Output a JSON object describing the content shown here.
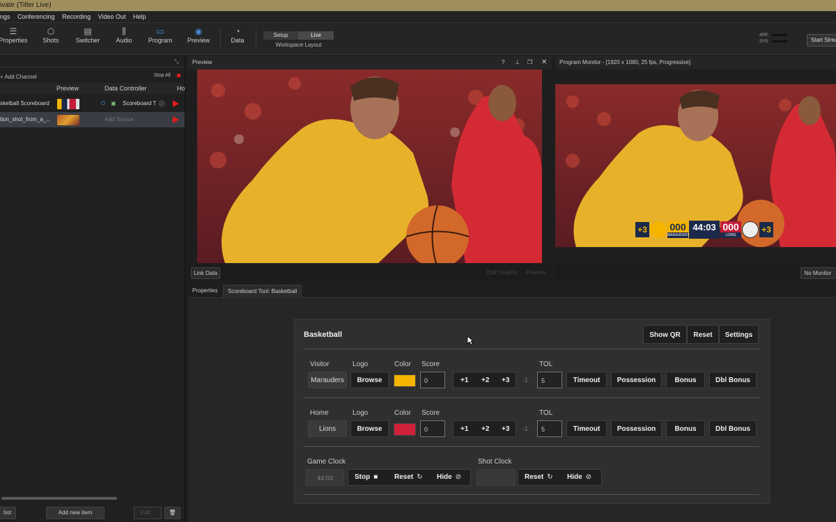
{
  "window": {
    "title": "ivate (Titler Live)"
  },
  "menu": [
    "ngs",
    "Conferencing",
    "Recording",
    "Video Out",
    "Help"
  ],
  "toolbar": {
    "items": [
      {
        "label": "Properties",
        "icon": "list-icon"
      },
      {
        "label": "Shots",
        "icon": "cube-icon"
      },
      {
        "label": "Switcher",
        "icon": "switcher-icon"
      },
      {
        "label": "Audio",
        "icon": "sliders-icon"
      },
      {
        "label": "Program",
        "icon": "monitor-icon"
      },
      {
        "label": "Preview",
        "icon": "eye-icon"
      },
      {
        "label": "Data",
        "icon": "pie-chart-icon"
      }
    ],
    "workspace": {
      "setup": "Setup",
      "live": "Live",
      "label": "Workspace Layout"
    },
    "meters": {
      "app": "APP:",
      "sys": "SYS:"
    },
    "start_stream": "Start Stream"
  },
  "channels": {
    "add_channel": "+ Add Channel",
    "stop_all": "Stop All",
    "columns": {
      "preview": "Preview",
      "data_controller": "Data Controller",
      "hotkey": "Ho"
    },
    "rows": [
      {
        "name": "sketball Scoreboard",
        "controller": "Scoreboard T"
      },
      {
        "name": "tion_shot_from_a_...",
        "controller": "Add Source"
      }
    ],
    "bottom": {
      "shot": "hot",
      "add_new_item": "Add new item",
      "edit": "Edit..."
    }
  },
  "preview_monitor": {
    "title": "Preview",
    "link_data": "Link Data",
    "edit_graphic": "Edit Graphic",
    "preview_btn": "Preview"
  },
  "program_monitor": {
    "title": "Program Monitor - [1920 x 1080, 25 fps, Progressive]",
    "no_monitor": "No Monitor"
  },
  "overlay": {
    "plus_left": "+3",
    "visitor_score": "000",
    "clock": "44:03",
    "visitor_name": "MARAUDERS",
    "home_name": "LIONS",
    "home_score": "000",
    "plus_right": "+3"
  },
  "tabs": [
    "Properties",
    "Scoreboard Tool: Basketball"
  ],
  "scoreboard": {
    "title": "Basketball",
    "actions": [
      "Show QR",
      "Reset",
      "Settings"
    ],
    "visitor": {
      "label": "Visitor",
      "name": "Marauders",
      "logo_label": "Logo",
      "browse": "Browse",
      "color_label": "Color",
      "color": "#f4b400",
      "score_label": "Score",
      "score": "0",
      "tol_label": "TOL",
      "tol": "5"
    },
    "home": {
      "label": "Home",
      "name": "Lions",
      "logo_label": "Logo",
      "browse": "Browse",
      "color_label": "Color",
      "color": "#d0213a",
      "score_label": "Score",
      "score": "0",
      "tol_label": "TOL",
      "tol": "5"
    },
    "increments": [
      "+1",
      "+2",
      "+3",
      "-1"
    ],
    "team_actions": [
      "Timeout",
      "Possession",
      "Bonus",
      "Dbl Bonus"
    ],
    "game_clock": {
      "label": "Game Clock",
      "value": "44:03",
      "stop": "Stop",
      "reset": "Reset",
      "hide": "Hide"
    },
    "shot_clock": {
      "label": "Shot Clock",
      "value": "",
      "reset": "Reset",
      "hide": "Hide"
    }
  }
}
